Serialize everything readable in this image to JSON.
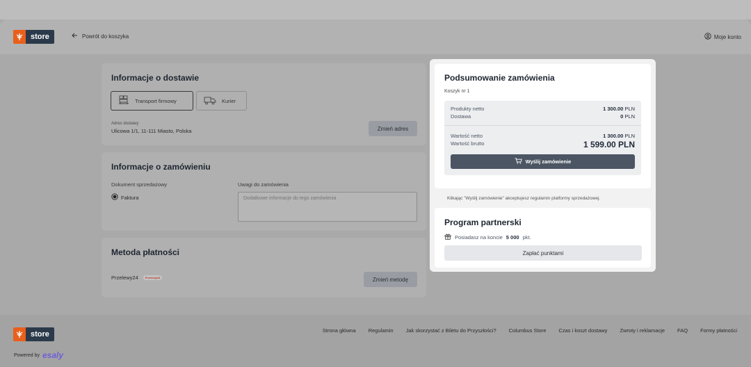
{
  "header": {
    "logo_text": "store",
    "back_label": "Powrót do koszyka",
    "account_label": "Moje konto"
  },
  "delivery": {
    "title": "Informacje o dostawie",
    "options": [
      {
        "label": "Transport firmowy",
        "icon": "pallet-icon",
        "selected": true
      },
      {
        "label": "Kurier",
        "icon": "truck-icon",
        "selected": false
      }
    ],
    "address_label": "Adres dostawy",
    "address_value": "Ulicowa 1/1, 11-111 Miasto, Polska",
    "change_address_button": "Zmień adres"
  },
  "order_info": {
    "title": "Informacje o zamówieniu",
    "document_label": "Dokument sprzedażowy",
    "document_option": "Faktura",
    "notes_label": "Uwagi do zamówienia",
    "notes_placeholder": "Dodatkowe informacje do tego zamówienia"
  },
  "payment": {
    "title": "Metoda płatności",
    "method": "Przelewy24",
    "method_logo": "Przelewy24",
    "change_method_button": "Zmień metodę"
  },
  "summary": {
    "title": "Podsumowanie zamówienia",
    "cart_label": "Koszyk nr 1",
    "net_products_label": "Produkty netto",
    "net_products_value": "1 300.00",
    "delivery_label": "Dostawa",
    "delivery_value": "0",
    "net_total_label": "Wartość netto",
    "net_total_value": "1 300.00",
    "gross_total_label": "Wartość brutto",
    "gross_total_value": "1 599.00 PLN",
    "currency": "PLN",
    "send_button": "Wyślij zamówienie",
    "terms_note": "Klikając \"Wyślij zamówienie\" akceptujesz regulamin platformy sprzedażowej."
  },
  "partner": {
    "title": "Program partnerski",
    "points_prefix": "Posiadasz na koncie",
    "points_value": "5 000",
    "points_unit": "pkt.",
    "pay_points_button": "Zapłać punktami"
  },
  "footer": {
    "logo_text": "store",
    "links": [
      "Strona główna",
      "Regulamin",
      "Jak skorzystać z Biletu do Przyszłości?",
      "Columbus Store",
      "Czas i koszt dostawy",
      "Zwroty i reklamacje",
      "FAQ",
      "Formy płatności"
    ],
    "powered_by": "Powered by",
    "powered_brand": "esaly"
  },
  "colors": {
    "brand_orange": "#e8601c",
    "brand_navy": "#2b3a4a",
    "button_dark": "#4b5563",
    "esaly_purple": "#6d5fd6"
  }
}
